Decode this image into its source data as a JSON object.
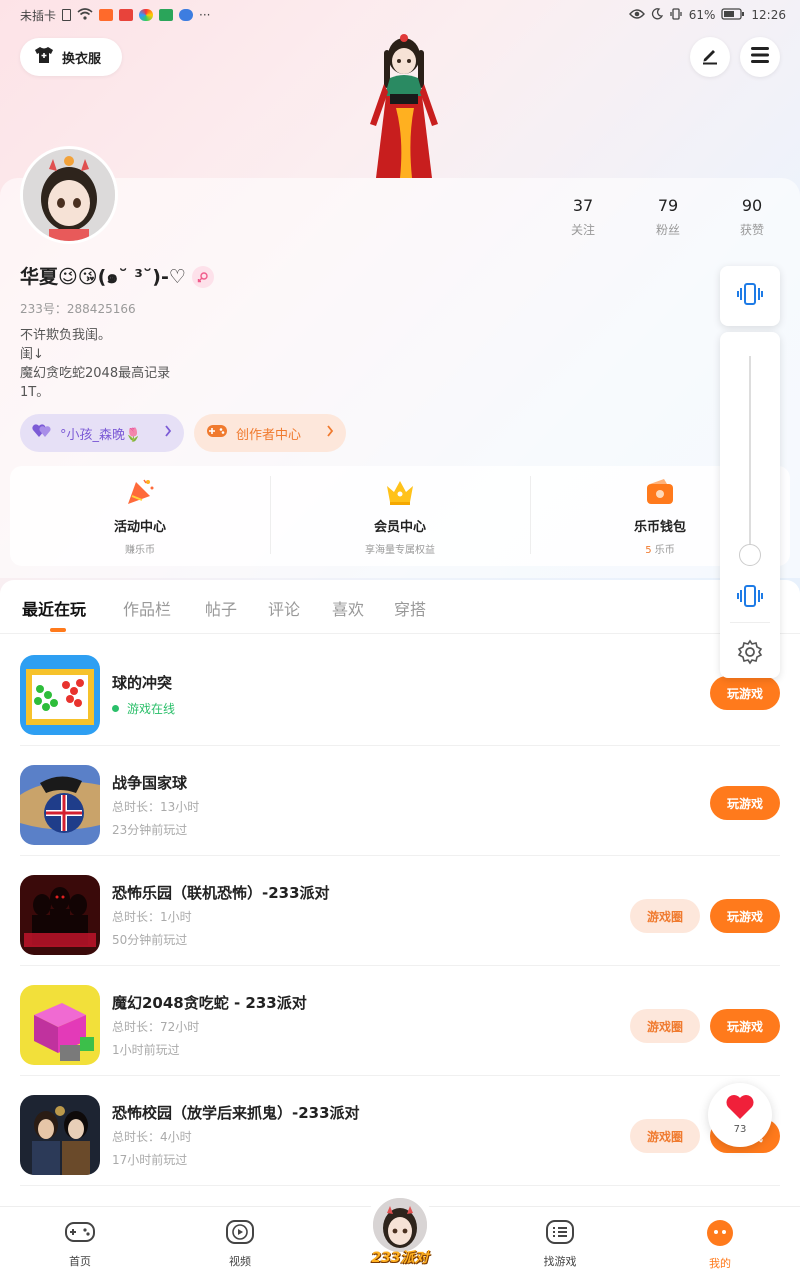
{
  "status_bar": {
    "carrier": "未插卡",
    "battery": "61%",
    "time": "12:26",
    "more": "···"
  },
  "header": {
    "outfit_label": "换衣服",
    "icons": [
      "edit-icon",
      "menu-icon"
    ]
  },
  "profile": {
    "name": "华夏😉😘(๑˘ ³˘)-♡",
    "uid": "233号：288425166",
    "bio": [
      "不许欺负我闺。",
      "闺↓",
      "魔幻贪吃蛇2048最高记录",
      "1T。"
    ],
    "stats": [
      {
        "num": "37",
        "label": "关注"
      },
      {
        "num": "79",
        "label": "粉丝"
      },
      {
        "num": "90",
        "label": "获赞"
      }
    ],
    "pill_friend": "°小孩_森晚🌷",
    "pill_creator": "创作者中心"
  },
  "services": [
    {
      "title": "活动中心",
      "sub": "赚乐币",
      "icon": "party-icon"
    },
    {
      "title": "会员中心",
      "sub": "享海量专属权益",
      "icon": "crown-icon"
    },
    {
      "title": "乐币钱包",
      "sub_value": "5",
      "sub_unit": " 乐币",
      "icon": "wallet-icon"
    }
  ],
  "tabs": [
    "最近在玩",
    "作品栏",
    "帖子",
    "评论",
    "喜欢",
    "穿搭"
  ],
  "games": [
    {
      "title": "球的冲突",
      "online": "游戏在线",
      "play": "玩游戏",
      "colors": [
        "#f6c22b",
        "#2e9ff2"
      ]
    },
    {
      "title": "战争国家球",
      "duration": "总时长：13小时",
      "last": "23分钟前玩过",
      "play": "玩游戏",
      "colors": [
        "#5a80c8",
        "#c9a36a"
      ]
    },
    {
      "title": "恐怖乐园（联机恐怖）-233派对",
      "duration": "总时长：1小时",
      "last": "50分钟前玩过",
      "circle": "游戏圈",
      "play": "玩游戏",
      "colors": [
        "#3a0a0a",
        "#c0142a"
      ]
    },
    {
      "title": "魔幻2048贪吃蛇 - 233派对",
      "duration": "总时长：72小时",
      "last": "1小时前玩过",
      "circle": "游戏圈",
      "play": "玩游戏",
      "colors": [
        "#f2e03a",
        "#e33ab8"
      ]
    },
    {
      "title": "恐怖校园（放学后来抓鬼）-233派对",
      "duration": "总时长：4小时",
      "last": "17小时前玩过",
      "circle": "游戏圈",
      "play": "玩游戏",
      "colors": [
        "#1d2432",
        "#6a4a2a"
      ]
    }
  ],
  "float_like": {
    "count": "73"
  },
  "bottom_nav": {
    "home": "首页",
    "video": "视频",
    "center": "233派对",
    "find": "找游戏",
    "mine": "我的"
  },
  "accent": "#ff7a1c"
}
